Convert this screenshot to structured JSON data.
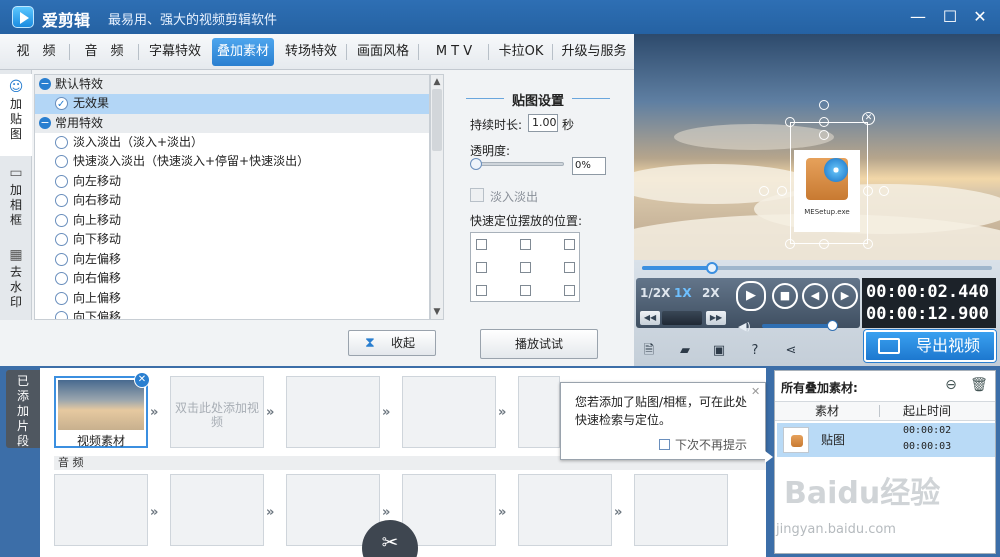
{
  "app": {
    "name": "爱剪辑",
    "slogan": "最易用、强大的视频剪辑软件",
    "min_glyph": "—",
    "max_glyph": "☐",
    "close_glyph": "✕"
  },
  "tabs": [
    "视　频",
    "音　频",
    "字幕特效",
    "叠加素材",
    "转场特效",
    "画面风格",
    "M T V",
    "卡拉OK",
    "升级与服务"
  ],
  "active_tab": "叠加素材",
  "side_tabs": [
    "加贴图",
    "加相框",
    "去水印"
  ],
  "effects": {
    "groups": [
      {
        "name": "默认特效",
        "items": [
          "无效果"
        ]
      },
      {
        "name": "常用特效",
        "items": [
          "淡入淡出（淡入+淡出）",
          "快速淡入淡出（快速淡入+停留+快速淡出）",
          "向左移动",
          "向右移动",
          "向上移动",
          "向下移动",
          "向左偏移",
          "向右偏移",
          "向上偏移",
          "向下偏移"
        ]
      }
    ],
    "selected": "无效果",
    "collapse_icon": "−"
  },
  "collapse_label": "收起",
  "settings": {
    "title": "贴图设置",
    "duration_label": "持续时长:",
    "duration_value": "1.00",
    "duration_unit": "秒",
    "opacity_label": "透明度:",
    "opacity_value": "0%",
    "fade_label": "淡入淡出",
    "position_label": "快速定位摆放的位置:",
    "play_test": "播放试试"
  },
  "sticker": {
    "caption": "MESetup.exe"
  },
  "player": {
    "seek_progress": 0.2,
    "speeds": [
      "1/2X",
      "1X",
      "2X"
    ],
    "active_speed": "1X",
    "time_current": "00:00:02.440",
    "time_total": "00:00:12.900",
    "volume": 0.92,
    "export_label": "导出视频"
  },
  "timeline": {
    "label": "已添加片段",
    "clips": [
      {
        "caption": "视频素材",
        "type": "video"
      },
      {
        "hint": "双击此处添加视频",
        "type": "empty"
      }
    ],
    "audio_label": "音 频"
  },
  "tooltip": {
    "text": "您若添加了贴图/相框，可在此处快速检索与定位。",
    "dont_show": "下次不再提示",
    "close_glyph": "✕"
  },
  "overlay_list": {
    "title": "所有叠加素材:",
    "col_material": "素材",
    "col_start": "起止时间",
    "rows": [
      {
        "name": "贴图",
        "start": "00:00:02",
        "end": "00:00:03"
      }
    ]
  },
  "watermark": {
    "logo": "Baidu经验",
    "url": "jingyan.baidu.com"
  }
}
